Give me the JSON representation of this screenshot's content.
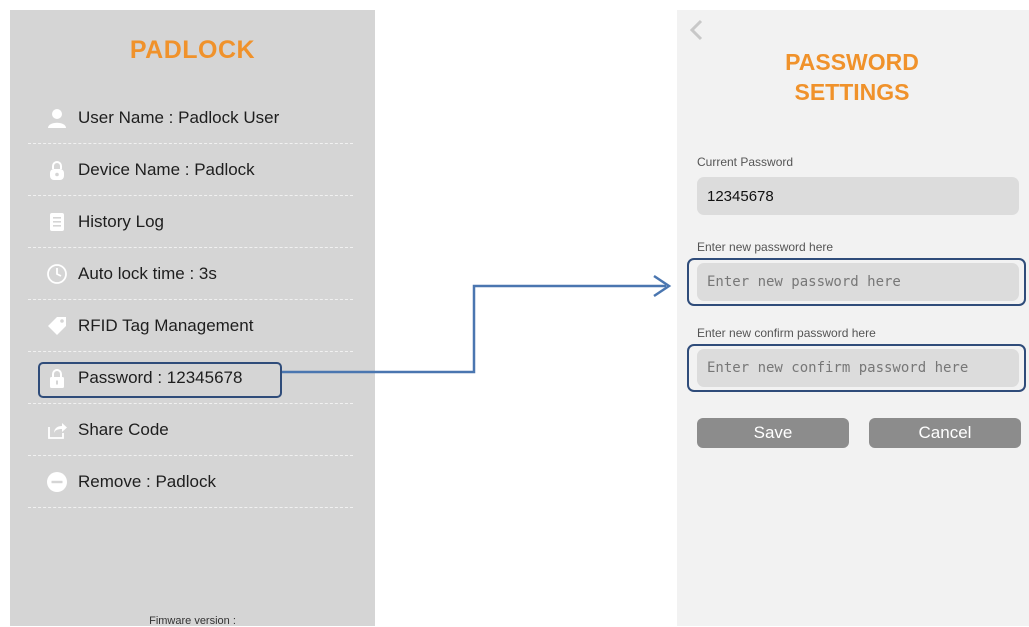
{
  "left": {
    "title": "PADLOCK",
    "items": [
      {
        "label": "User Name : Padlock User",
        "icon": "user-icon"
      },
      {
        "label": "Device Name : Padlock",
        "icon": "lock-icon"
      },
      {
        "label": "History Log",
        "icon": "list-icon"
      },
      {
        "label": "Auto lock time : 3s",
        "icon": "clock-icon"
      },
      {
        "label": "RFID Tag Management",
        "icon": "tag-icon"
      },
      {
        "label": "Password : 12345678",
        "icon": "padlock-icon"
      },
      {
        "label": "Share Code",
        "icon": "share-icon"
      },
      {
        "label": "Remove : Padlock",
        "icon": "minus-circle-icon"
      }
    ],
    "firmware": "Fimware version :"
  },
  "right": {
    "title_line1": "PASSWORD",
    "title_line2": "SETTINGS",
    "current_password_label": "Current Password",
    "current_password_value": "12345678",
    "new_password_label": "Enter new password here",
    "new_password_placeholder": "Enter new password here",
    "confirm_password_label": "Enter new confirm password here",
    "confirm_password_placeholder": "Enter new confirm password here",
    "save_label": "Save",
    "cancel_label": "Cancel"
  },
  "colors": {
    "accent": "#f0922b",
    "highlight": "#2f4c7a",
    "arrow": "#4a76b0",
    "button": "#8c8c8c",
    "icon": "#ffffff"
  }
}
